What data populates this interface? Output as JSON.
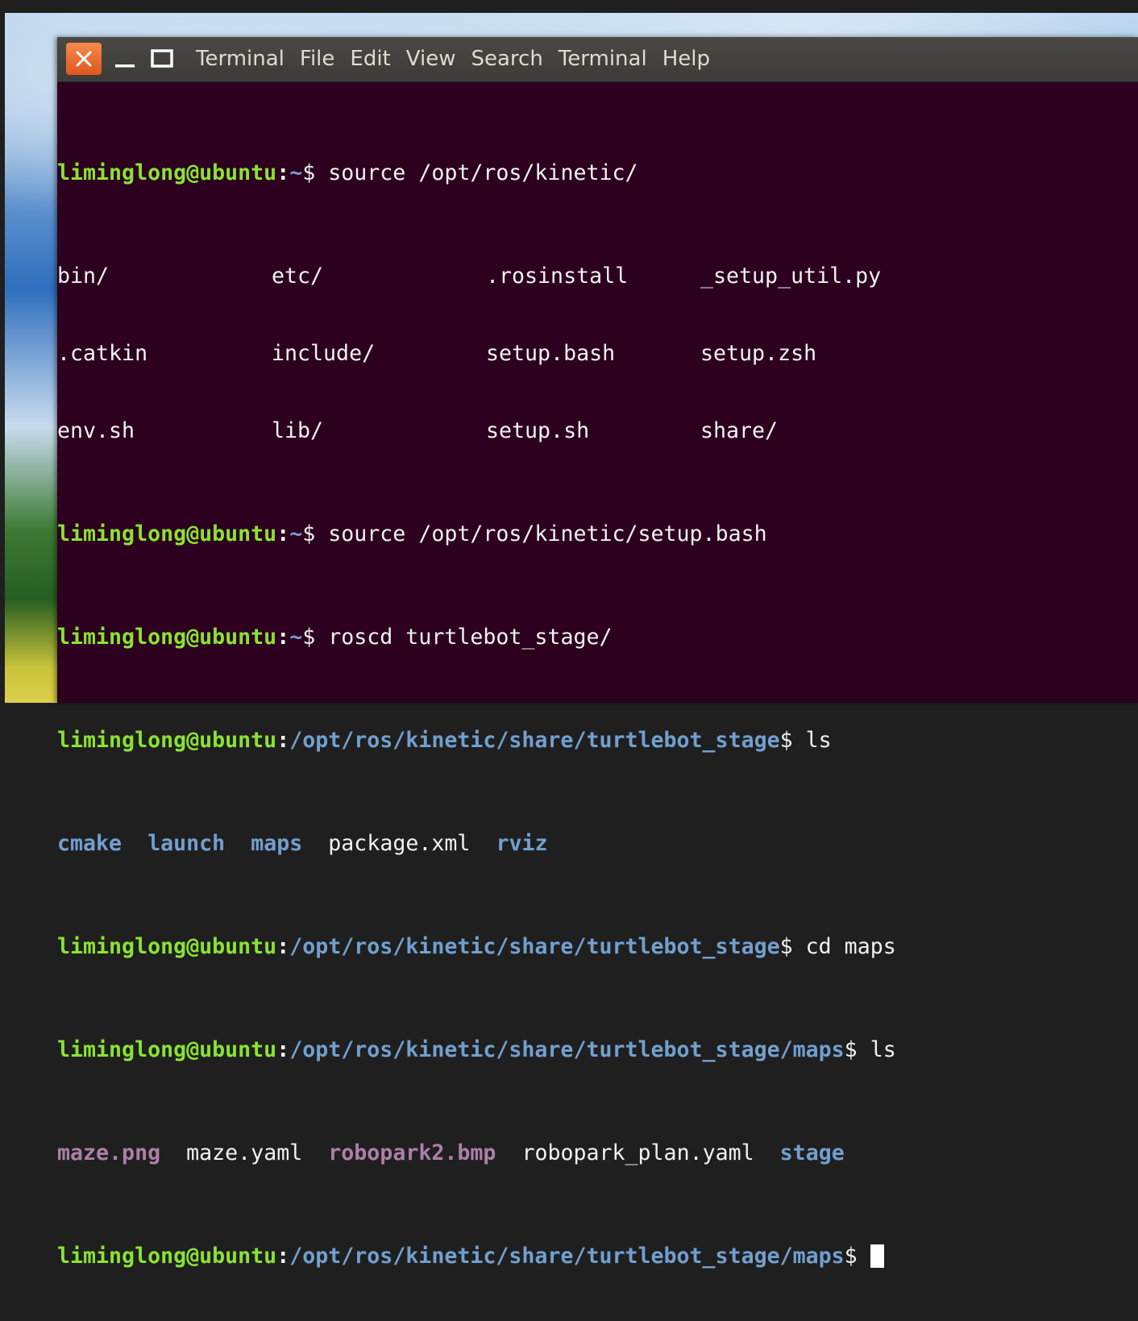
{
  "window": {
    "menus": [
      "Terminal",
      "File",
      "Edit",
      "View",
      "Search",
      "Terminal",
      "Help"
    ]
  },
  "terminal": {
    "lines": [
      {
        "user": "liminglong@ubuntu",
        "colon": ":",
        "path": "~",
        "dollar": "$",
        "cmd": " source /opt/ros/kinetic/"
      },
      {
        "cols": [
          {
            "text": "bin/",
            "kind": "fg"
          },
          {
            "text": "etc/",
            "kind": "fg"
          },
          {
            "text": ".rosinstall",
            "kind": "fg"
          },
          {
            "text": "_setup_util.py",
            "kind": "fg"
          }
        ]
      },
      {
        "cols": [
          {
            "text": ".catkin",
            "kind": "fg"
          },
          {
            "text": "include/",
            "kind": "fg"
          },
          {
            "text": "setup.bash",
            "kind": "fg"
          },
          {
            "text": "setup.zsh",
            "kind": "fg"
          }
        ]
      },
      {
        "cols": [
          {
            "text": "env.sh",
            "kind": "fg"
          },
          {
            "text": "lib/",
            "kind": "fg"
          },
          {
            "text": "setup.sh",
            "kind": "fg"
          },
          {
            "text": "share/",
            "kind": "fg"
          }
        ]
      },
      {
        "user": "liminglong@ubuntu",
        "colon": ":",
        "path": "~",
        "dollar": "$",
        "cmd": " source /opt/ros/kinetic/setup.bash"
      },
      {
        "user": "liminglong@ubuntu",
        "colon": ":",
        "path": "~",
        "dollar": "$",
        "cmd": " roscd turtlebot_stage/"
      },
      {
        "user": "liminglong@ubuntu",
        "colon": ":",
        "path": "/opt/ros/kinetic/share/turtlebot_stage",
        "dollar": "$",
        "cmd": " ls"
      },
      {
        "list": [
          {
            "text": "cmake",
            "kind": "dir"
          },
          {
            "text": "launch",
            "kind": "dir"
          },
          {
            "text": "maps",
            "kind": "dir"
          },
          {
            "text": "package.xml",
            "kind": "fg"
          },
          {
            "text": "rviz",
            "kind": "dir"
          }
        ]
      },
      {
        "user": "liminglong@ubuntu",
        "colon": ":",
        "path": "/opt/ros/kinetic/share/turtlebot_stage",
        "dollar": "$",
        "cmd": " cd maps"
      },
      {
        "user": "liminglong@ubuntu",
        "colon": ":",
        "path": "/opt/ros/kinetic/share/turtlebot_stage/maps",
        "dollar": "$",
        "cmd": " ls"
      },
      {
        "list": [
          {
            "text": "maze.png",
            "kind": "img"
          },
          {
            "text": "maze.yaml",
            "kind": "fg"
          },
          {
            "text": "robopark2.bmp",
            "kind": "img"
          },
          {
            "text": "robopark_plan.yaml",
            "kind": "fg"
          },
          {
            "text": "stage",
            "kind": "dir"
          }
        ]
      },
      {
        "user": "liminglong@ubuntu",
        "colon": ":",
        "path": "/opt/ros/kinetic/share/turtlebot_stage/maps",
        "dollar": "$",
        "cmd": "",
        "cursor": true
      }
    ]
  },
  "colors": {
    "background": "#2c001e",
    "user": "#8ae234",
    "path": "#729fcf",
    "image_file": "#ad7fa8",
    "close_button": "#e95420"
  },
  "icons": {
    "close": "close-icon",
    "minimize": "minimize-icon",
    "maximize": "maximize-icon"
  }
}
